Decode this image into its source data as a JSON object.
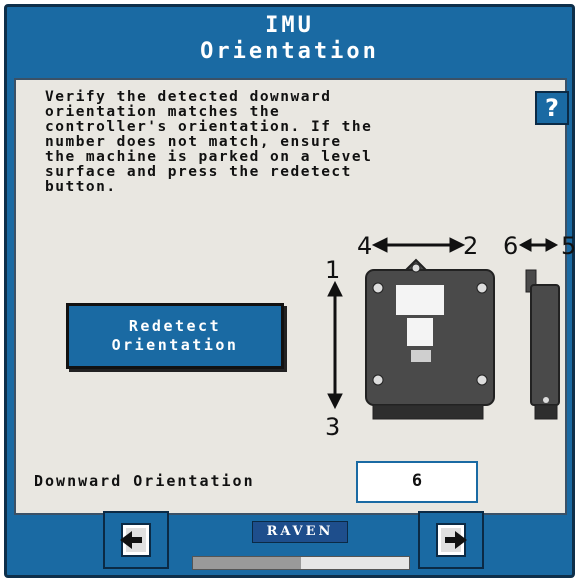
{
  "header": {
    "title_line1": "IMU",
    "title_line2": "Orientation"
  },
  "instructions": "Verify the detected downward\norientation matches the\ncontroller's orientation. If the\nnumber does not match, ensure\nthe machine is parked on a level\nsurface and press the redetect\nbutton.",
  "help_button": {
    "label": "?"
  },
  "redetect_button": {
    "label": "Redetect\nOrientation"
  },
  "diagram": {
    "axis_left_top": "4",
    "axis_left_right": "2",
    "axis_side_left": "6",
    "axis_side_right": "5",
    "axis_vertical_top": "1",
    "axis_vertical_bottom": "3"
  },
  "downward_orientation": {
    "label": "Downward Orientation",
    "value": "6"
  },
  "footer": {
    "back_icon": "arrow-left-icon",
    "next_icon": "arrow-right-icon",
    "logo_text": "RAVEN",
    "progress_fraction": 0.5
  },
  "colors": {
    "primary_blue": "#1a6aa3",
    "panel_bg": "#e9e7e1",
    "device_body": "#4a4a4a"
  }
}
